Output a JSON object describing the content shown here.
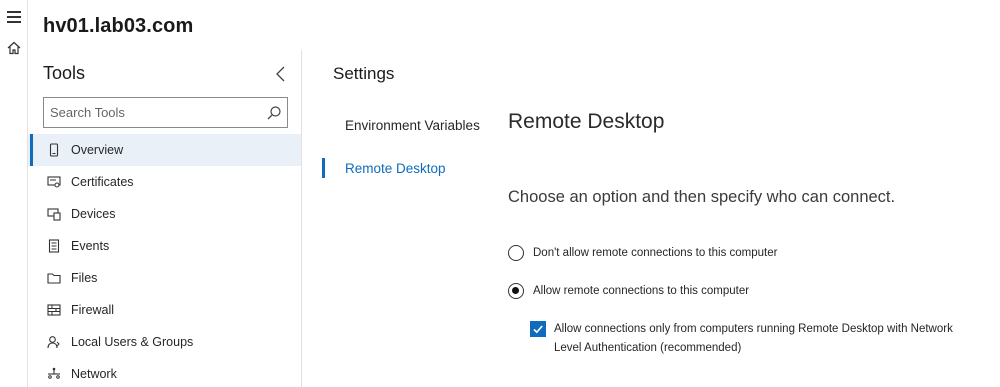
{
  "header": {
    "server_name": "hv01.lab03.com"
  },
  "rail": {
    "menu_icon": "hamburger-menu-icon",
    "home_icon": "home-icon"
  },
  "tools": {
    "heading": "Tools",
    "collapse_icon": "chevron-left-icon",
    "search_placeholder": "Search Tools",
    "search_icon": "search-icon",
    "items": [
      {
        "label": "Overview",
        "icon": "server-icon",
        "active": true
      },
      {
        "label": "Certificates",
        "icon": "certificate-icon"
      },
      {
        "label": "Devices",
        "icon": "devices-icon"
      },
      {
        "label": "Events",
        "icon": "events-icon"
      },
      {
        "label": "Files",
        "icon": "folder-icon"
      },
      {
        "label": "Firewall",
        "icon": "firewall-icon"
      },
      {
        "label": "Local Users & Groups",
        "icon": "users-icon"
      },
      {
        "label": "Network",
        "icon": "network-icon"
      }
    ]
  },
  "settings": {
    "heading": "Settings",
    "nav": [
      {
        "label": "Environment Variables",
        "active": false
      },
      {
        "label": "Remote Desktop",
        "active": true
      }
    ]
  },
  "remote_desktop": {
    "title": "Remote Desktop",
    "subtitle": "Choose an option and then specify who can connect.",
    "option_disallow": "Don't allow remote connections to this computer",
    "option_allow": "Allow remote connections to this computer",
    "selected": "allow",
    "nla_label": "Allow connections only from computers running Remote Desktop with Network Level Authentication (recommended)",
    "nla_checked": true
  },
  "colors": {
    "accent": "#0f6cbd",
    "active_bg": "#e9f0f7"
  }
}
